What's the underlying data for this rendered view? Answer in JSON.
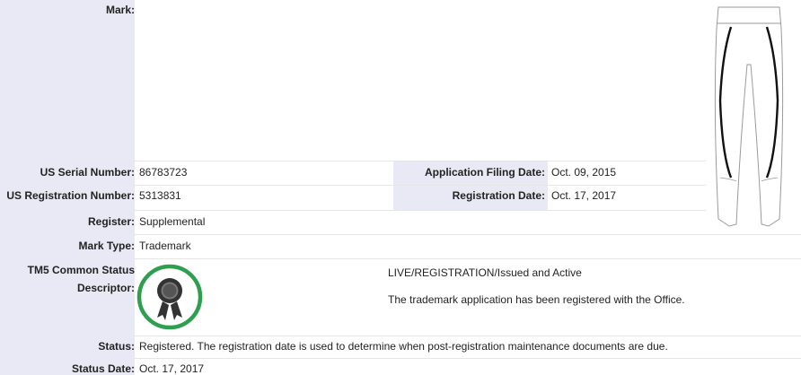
{
  "mark": {
    "label": "Mark:"
  },
  "serial": {
    "label": "US Serial Number:",
    "value": "86783723"
  },
  "filing": {
    "label": "Application Filing Date:",
    "value": "Oct. 09, 2015"
  },
  "registration_number": {
    "label": "US Registration Number:",
    "value": "5313831"
  },
  "registration_date": {
    "label": "Registration Date:",
    "value": "Oct. 17, 2017"
  },
  "register": {
    "label": "Register:",
    "value": "Supplemental"
  },
  "mark_type": {
    "label": "Mark Type:",
    "value": "Trademark"
  },
  "tm5": {
    "label_line1": "TM5 Common Status",
    "label_line2": "Descriptor:",
    "status_title": "LIVE/REGISTRATION/Issued and Active",
    "status_desc": "The trademark application has been registered with the Office.",
    "badge_icon": "registered-award-icon",
    "badge_color": "#2e9e4f"
  },
  "status": {
    "label": "Status:",
    "value": "Registered. The registration date is used to determine when post-registration maintenance documents are due."
  },
  "status_date": {
    "label": "Status Date:",
    "value": "Oct. 17, 2017"
  }
}
